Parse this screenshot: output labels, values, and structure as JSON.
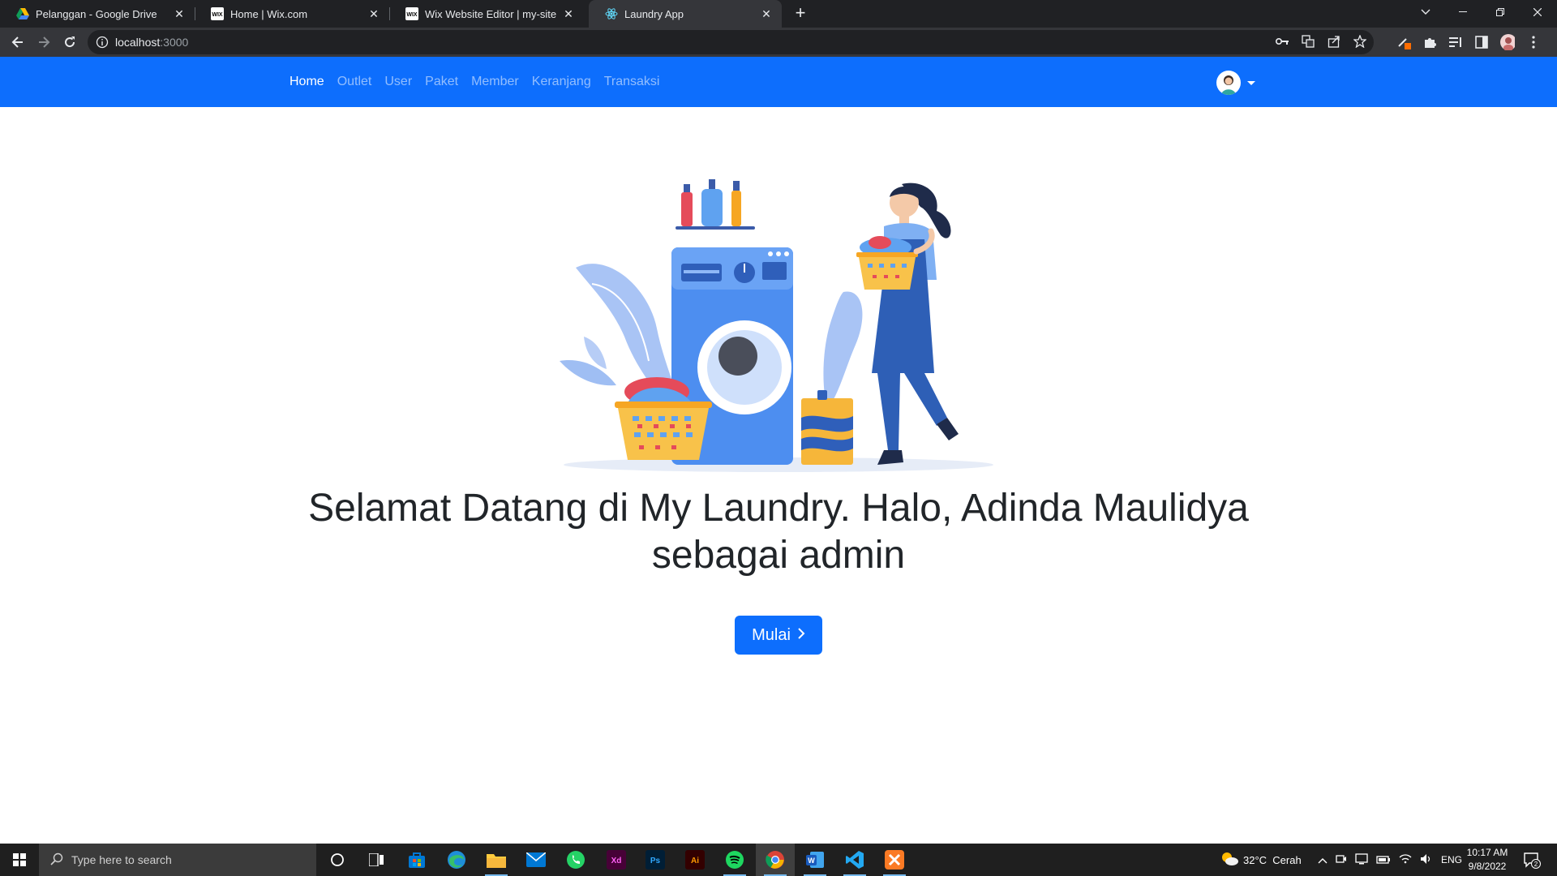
{
  "browser": {
    "tabs": [
      {
        "title": "Pelanggan - Google Drive",
        "icon": "google-drive-icon"
      },
      {
        "title": "Home | Wix.com",
        "icon": "wix-icon"
      },
      {
        "title": "Wix Website Editor | my-site",
        "icon": "wix-icon"
      },
      {
        "title": "Laundry App",
        "icon": "react-icon"
      }
    ],
    "url_host": "localhost",
    "url_port": ":3000"
  },
  "navbar": {
    "links": [
      "Home",
      "Outlet",
      "User",
      "Paket",
      "Member",
      "Keranjang",
      "Transaksi"
    ],
    "active": "Home",
    "color": "#0d6efd"
  },
  "hero": {
    "headline": "Selamat Datang di My Laundry. Halo, Adinda Maulidya sebagai admin",
    "button_label": "Mulai"
  },
  "taskbar": {
    "search_placeholder": "Type here to search",
    "weather": "32°C  Cerah",
    "language": "ENG",
    "time": "10:17 AM",
    "date": "9/8/2022",
    "notification_count": "2"
  }
}
